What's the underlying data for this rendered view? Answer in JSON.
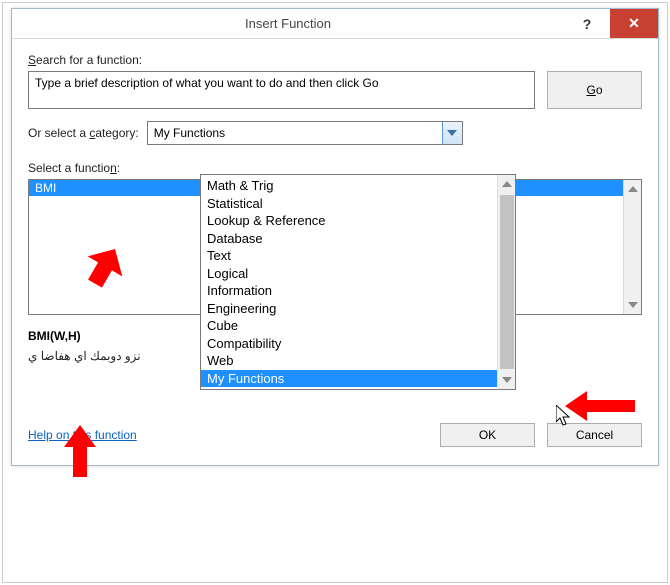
{
  "window": {
    "title": "Insert Function",
    "help_btn": "?",
    "close_btn": "✕"
  },
  "labels": {
    "search_pre": "",
    "search_u": "S",
    "search_post": "earch for a function:",
    "category_pre": "Or select a ",
    "category_u": "c",
    "category_post": "ategory:",
    "select_func_pre": "Select a functio",
    "select_func_u": "n",
    "select_func_post": ":"
  },
  "search": {
    "placeholder": "Type a brief description of what you want to do and then click Go"
  },
  "buttons": {
    "go_u": "G",
    "go_post": "o",
    "ok": "OK",
    "cancel": "Cancel"
  },
  "category": {
    "selected": "My Functions",
    "options": [
      "Math & Trig",
      "Statistical",
      "Lookup & Reference",
      "Database",
      "Text",
      "Logical",
      "Information",
      "Engineering",
      "Cube",
      "Compatibility",
      "Web",
      "My Functions"
    ]
  },
  "func": {
    "selected": "BMI",
    "signature": "BMI(W,H)",
    "description": "ي اضافه يا كمبود وزن"
  },
  "help_link": "Help on this function"
}
